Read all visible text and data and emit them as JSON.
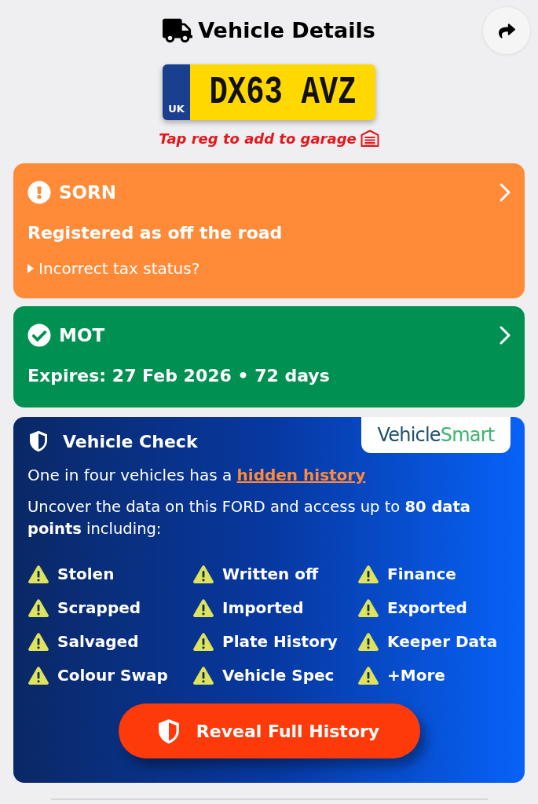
{
  "header": {
    "title": "Vehicle Details"
  },
  "plate": {
    "country": "UK",
    "registration": "DX63 AVZ"
  },
  "garage_hint": "Tap reg to add to garage",
  "status_cards": [
    {
      "kind": "warning",
      "title": "SORN",
      "detail": "Registered as off the road",
      "disclosure": {
        "label": "Incorrect tax status?",
        "expanded": false
      }
    },
    {
      "kind": "ok",
      "title": "MOT",
      "detail": "Expires: 27 Feb 2026 • 72 days"
    }
  ],
  "vehicle_check": {
    "title": "Vehicle Check",
    "logo": {
      "part_1": "Vehicle",
      "part_2": "Smart"
    },
    "teaser": {
      "text": "One in four vehicles has a",
      "link": "hidden history"
    },
    "description": "Uncover the data on this FORD and access up to **80 data points** including:",
    "data_points": [
      "Stolen",
      "Written off",
      "Finance",
      "Scrapped",
      "Imported",
      "Exported",
      "Salvaged",
      "Plate History",
      "Keeper Data",
      "Colour Swap",
      "Vehicle Spec",
      "+More"
    ],
    "button": "Reveal Full History"
  }
}
